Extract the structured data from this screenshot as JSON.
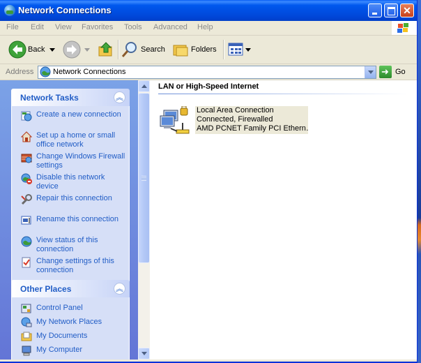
{
  "window": {
    "title": "Network Connections",
    "icon": "network-globe-icon"
  },
  "menu": [
    "File",
    "Edit",
    "View",
    "Favorites",
    "Tools",
    "Advanced",
    "Help"
  ],
  "toolbar": {
    "back_label": "Back",
    "search_label": "Search",
    "folders_label": "Folders"
  },
  "address": {
    "label": "Address",
    "value": "Network Connections",
    "go_label": "Go"
  },
  "network_tasks": {
    "title": "Network Tasks",
    "items": [
      {
        "label": "Create a new connection",
        "icon": "new-connection-icon"
      },
      {
        "label": "Set up a home or small office network",
        "icon": "home-network-icon"
      },
      {
        "label": "Change Windows Firewall settings",
        "icon": "firewall-icon"
      },
      {
        "label": "Disable this network device",
        "icon": "disable-device-icon"
      },
      {
        "label": "Repair this connection",
        "icon": "repair-wrench-icon"
      },
      {
        "label": "Rename this connection",
        "icon": "rename-icon"
      },
      {
        "label": "View status of this connection",
        "icon": "status-globe-icon"
      },
      {
        "label": "Change settings of this connection",
        "icon": "settings-document-icon"
      }
    ]
  },
  "other_places": {
    "title": "Other Places",
    "items": [
      {
        "label": "Control Panel",
        "icon": "control-panel-icon"
      },
      {
        "label": "My Network Places",
        "icon": "network-places-icon"
      },
      {
        "label": "My Documents",
        "icon": "folder-icon"
      },
      {
        "label": "My Computer",
        "icon": "computer-icon"
      }
    ]
  },
  "content": {
    "group_header": "LAN or High-Speed Internet",
    "connection": {
      "name": "Local Area Connection",
      "status": "Connected, Firewalled",
      "device": "AMD PCNET Family PCI Ethern…"
    }
  },
  "colors": {
    "title_bar": "#0054e3",
    "task_pane": "#6f8ce0",
    "link": "#215dc6",
    "selection": "#ece9d8"
  }
}
